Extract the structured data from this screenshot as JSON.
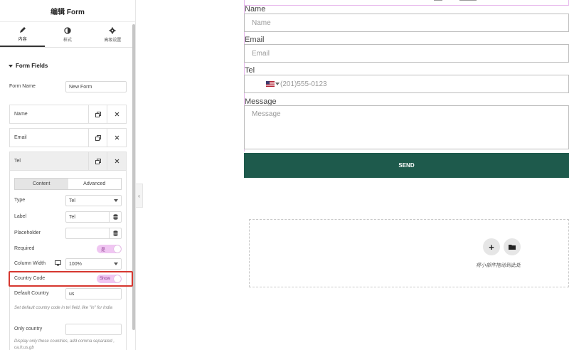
{
  "panel": {
    "title": "编辑 Form",
    "tabs": [
      {
        "label": "内容",
        "icon": "pencil-icon"
      },
      {
        "label": "样式",
        "icon": "contrast-icon"
      },
      {
        "label": "高级设置",
        "icon": "gear-icon"
      }
    ],
    "section_title": "Form Fields",
    "form_name_label": "Form Name",
    "form_name_value": "New Form",
    "fields": [
      {
        "label": "Name"
      },
      {
        "label": "Email"
      },
      {
        "label": "Tel"
      }
    ],
    "subtabs": [
      "Content",
      "Advanced"
    ],
    "type_label": "Type",
    "type_value": "Tel",
    "label_label": "Label",
    "label_value": "Tel",
    "placeholder_label": "Placeholder",
    "placeholder_value": "",
    "required_label": "Required",
    "required_toggle": "是",
    "column_width_label": "Column Width",
    "column_width_value": "100%",
    "country_code_label": "Country Code",
    "country_code_toggle": "Show",
    "default_country_label": "Default Country",
    "default_country_value": "us",
    "default_country_help": "Set default country code in tel field, like \"in\" for India",
    "only_country_label": "Only country",
    "only_country_value": "",
    "only_country_help": "Display only these countries, add comma separated , ca,fr,us,gb"
  },
  "preview": {
    "fields": [
      {
        "label": "Name",
        "placeholder": "Name"
      },
      {
        "label": "Email",
        "placeholder": "Email"
      },
      {
        "label": "Tel",
        "placeholder": "(201)555-0123"
      },
      {
        "label": "Message",
        "placeholder": "Message"
      }
    ],
    "send_label": "SEND",
    "drop_text": "将小部件拖动到此处",
    "add_icon": "+"
  },
  "colors": {
    "send_bg": "#1e5a4c",
    "highlight": "#d6372f",
    "toggle_bg": "#f0c6f2"
  }
}
